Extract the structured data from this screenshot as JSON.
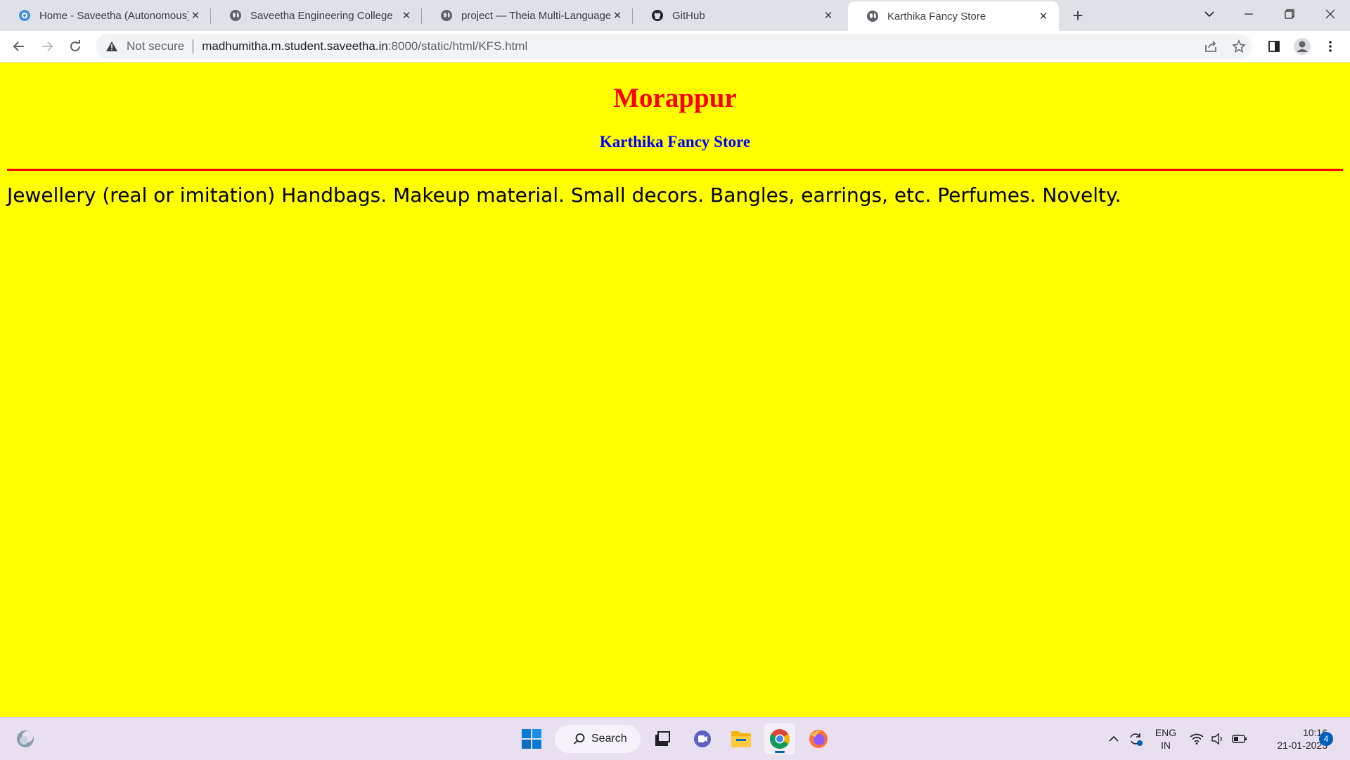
{
  "browser": {
    "tabs": [
      {
        "title": "Home - Saveetha (Autonomous)",
        "icon": "saveetha-favicon"
      },
      {
        "title": "Saveetha Engineering College",
        "icon": "globe-icon"
      },
      {
        "title": "project — Theia Multi-Language",
        "icon": "globe-icon"
      },
      {
        "title": "GitHub",
        "icon": "github-icon"
      },
      {
        "title": "Karthika Fancy Store",
        "icon": "globe-icon",
        "active": true
      }
    ],
    "omnibox": {
      "security_label": "Not secure",
      "host": "madhumitha.m.student.saveetha.in",
      "path": ":8000/static/html/KFS.html"
    }
  },
  "page": {
    "heading": "Morappur",
    "subheading": "Karthika Fancy Store",
    "paragraph": "Jewellery (real or imitation) Handbags. Makeup material. Small decors. Bangles, earrings, etc. Perfumes. Novelty.",
    "colors": {
      "background": "#ffff00",
      "heading": "#ff0000",
      "subheading": "#0000ff",
      "rule": "#ff0000"
    }
  },
  "taskbar": {
    "search_label": "Search",
    "language_line1": "ENG",
    "language_line2": "IN",
    "time": "10:16",
    "date": "21-01-2023",
    "notification_count": "4"
  }
}
